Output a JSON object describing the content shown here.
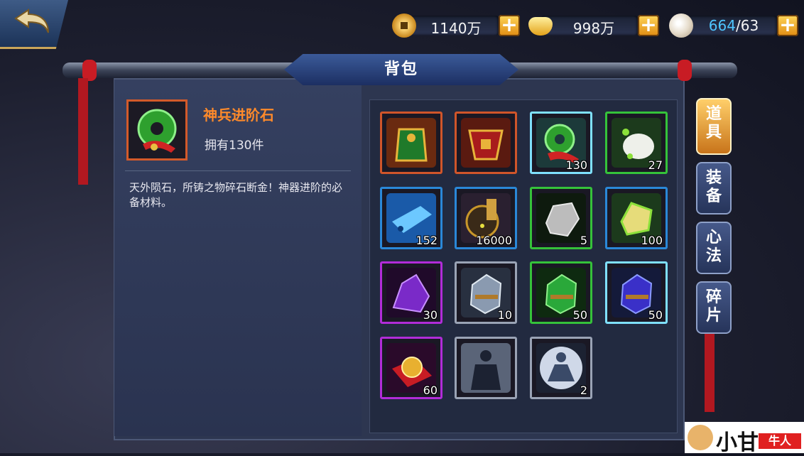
{
  "top_bar": {
    "coins": {
      "value": "1140万",
      "icon": "copper-coin-icon"
    },
    "gold": {
      "value": "998万",
      "icon": "gold-ingot-icon"
    },
    "stamina": {
      "current": "664",
      "separator": "/",
      "max": "63",
      "icon": "bun-icon"
    },
    "plus_label": "+"
  },
  "title": "背包",
  "selected_item": {
    "name": "神兵进阶石",
    "owned": "拥有130件",
    "description": "天外陨石，所铸之物碎石断金！神器进阶的必备材料。"
  },
  "inventory": [
    {
      "name": "green-helmet",
      "count": "",
      "quality": "orange"
    },
    {
      "name": "red-armor",
      "count": "",
      "quality": "orange"
    },
    {
      "name": "jade-pendant",
      "count": "130",
      "quality": "cyan"
    },
    {
      "name": "white-pouch",
      "count": "27",
      "quality": "green"
    },
    {
      "name": "blue-tile",
      "count": "152",
      "quality": "blue"
    },
    {
      "name": "scroll-bundle",
      "count": "16000",
      "quality": "blue"
    },
    {
      "name": "gray-ore",
      "count": "5",
      "quality": "green"
    },
    {
      "name": "yellow-crystal",
      "count": "100",
      "quality": "blue"
    },
    {
      "name": "purple-ore",
      "count": "30",
      "quality": "purple"
    },
    {
      "name": "silver-stone",
      "count": "10",
      "quality": "gray"
    },
    {
      "name": "green-stone",
      "count": "50",
      "quality": "green"
    },
    {
      "name": "blue-stone",
      "count": "50",
      "quality": "blue"
    },
    {
      "name": "golden-pearl",
      "count": "60",
      "quality": "purple"
    },
    {
      "name": "silhouette-figure",
      "count": "",
      "quality": "gray"
    },
    {
      "name": "meditating-figure",
      "count": "2",
      "quality": "gray"
    }
  ],
  "tabs": [
    {
      "label": "道具",
      "active": true
    },
    {
      "label": "装备",
      "active": false
    },
    {
      "label": "心法",
      "active": false
    },
    {
      "label": "碎片",
      "active": false
    }
  ],
  "watermark": {
    "text": "小甘",
    "badge": "牛人"
  }
}
